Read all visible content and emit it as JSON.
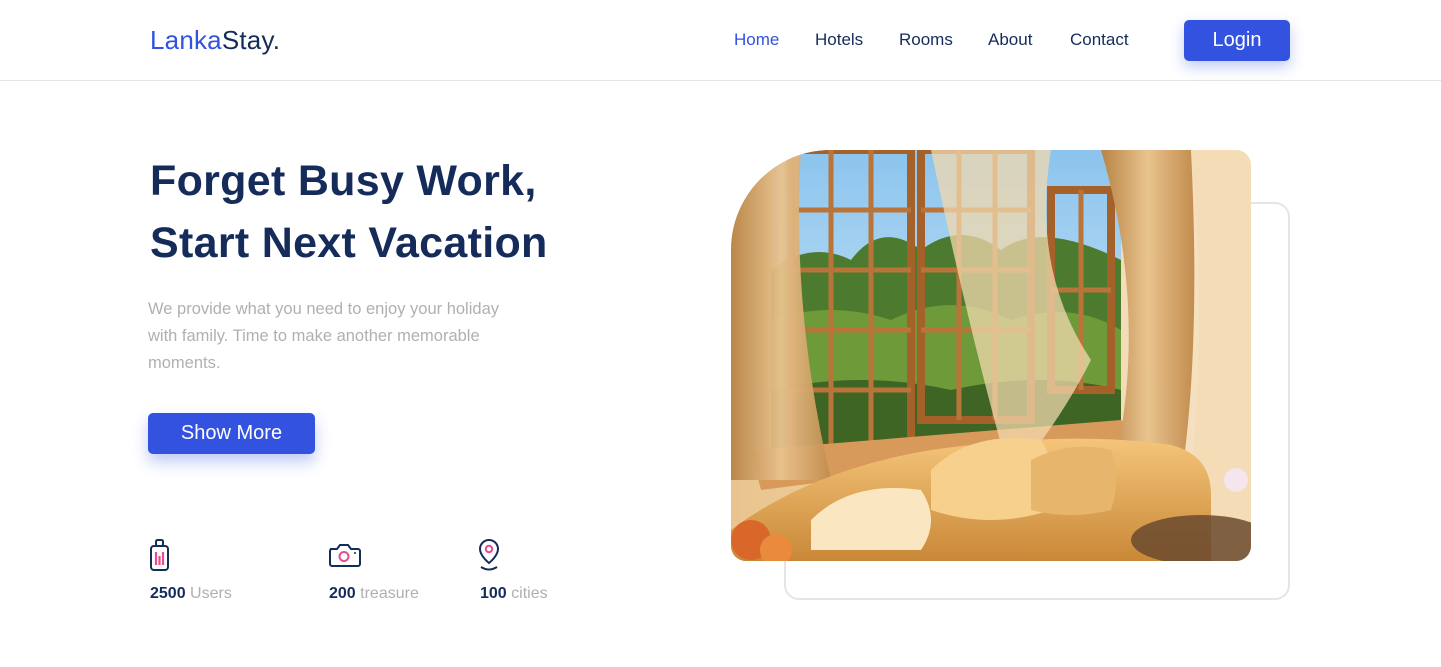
{
  "header": {
    "logo": {
      "part1": "Lanka",
      "part2": "Stay."
    },
    "nav": [
      {
        "label": "Home",
        "active": true
      },
      {
        "label": "Hotels",
        "active": false
      },
      {
        "label": "Rooms",
        "active": false
      },
      {
        "label": "About",
        "active": false
      },
      {
        "label": "Contact",
        "active": false
      }
    ],
    "login_label": "Login"
  },
  "hero": {
    "title_line1": "Forget Busy Work,",
    "title_line2": "Start Next Vacation",
    "description": "We provide what you need to enjoy your holiday with family. Time to make another memorable moments.",
    "cta_label": "Show More"
  },
  "stats": [
    {
      "icon": "luggage-icon",
      "value": "2500",
      "unit": "Users"
    },
    {
      "icon": "camera-icon",
      "value": "200",
      "unit": "treasure"
    },
    {
      "icon": "location-pin-icon",
      "value": "100",
      "unit": "cities"
    }
  ],
  "colors": {
    "primary": "#3252DF",
    "navy": "#152C5B",
    "muted": "#B0B0B0",
    "accent_pink": "#E44E8E"
  }
}
